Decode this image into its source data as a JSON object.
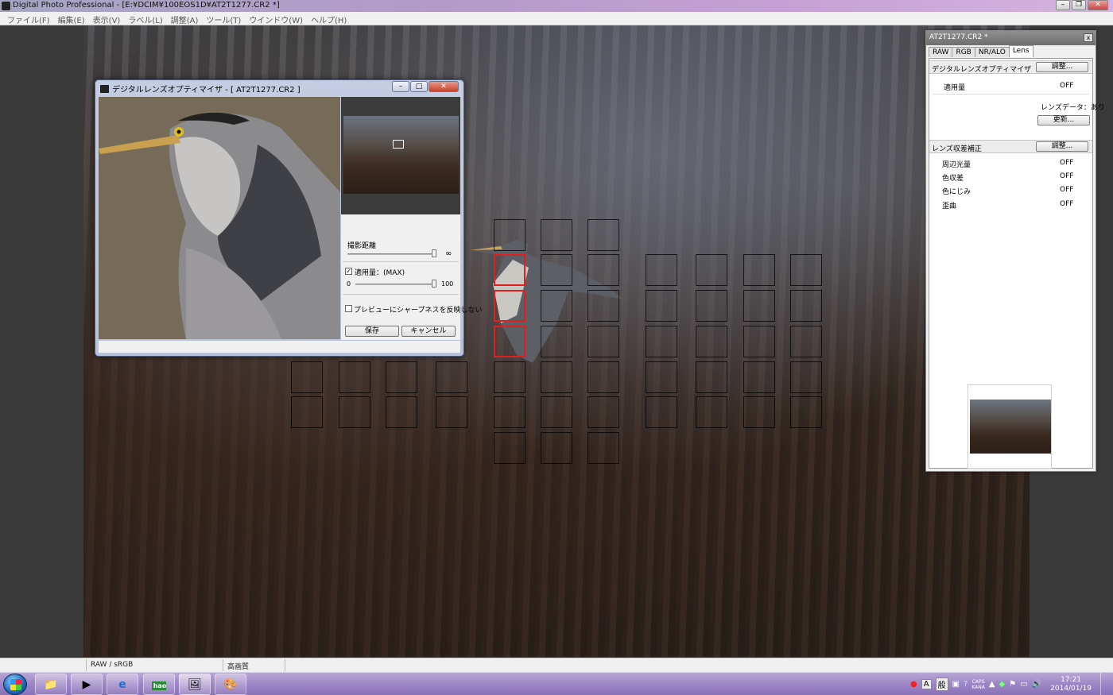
{
  "window": {
    "title": "Digital Photo Professional - [E:¥DCIM¥100EOS1D¥AT2T1277.CR2 *]",
    "controls": [
      "–",
      "❐",
      "✕"
    ]
  },
  "menu": [
    "ファイル(F)",
    "編集(E)",
    "表示(V)",
    "ラベル(L)",
    "調整(A)",
    "ツール(T)",
    "ウインドウ(W)",
    "ヘルプ(H)"
  ],
  "status": {
    "color_mode": "RAW / sRGB",
    "quality": "高画質"
  },
  "dlo": {
    "title": "デジタルレンズオプティマイザ - [ AT2T1277.CR2 ]",
    "controls": [
      "–",
      "□",
      "✕"
    ],
    "distance_label": "撮影距離",
    "distance_value": "∞",
    "apply_label": "適用量：(MAX)",
    "apply_checked": true,
    "apply_min": "0",
    "apply_max": "100",
    "no_sharpness_label": "プレビューにシャープネスを反映しない",
    "no_sharpness_checked": false,
    "save_label": "保存",
    "cancel_label": "キャンセル"
  },
  "palette": {
    "title": "AT2T1277.CR2 *",
    "close": "x",
    "tabs": [
      "RAW",
      "RGB",
      "NR/ALO",
      "Lens"
    ],
    "active_tab": "Lens",
    "dlo_section": {
      "label": "デジタルレンズオプティマイザ",
      "button": "調整...",
      "amount_label": "適用量",
      "amount_value": "OFF",
      "lens_data": "レンズデータ：あり",
      "update_button": "更新..."
    },
    "aberration_section": {
      "label": "レンズ収差補正",
      "button": "調整...",
      "items": [
        {
          "label": "周辺光量",
          "value": "OFF"
        },
        {
          "label": "色収差",
          "value": "OFF"
        },
        {
          "label": "色にじみ",
          "value": "OFF"
        },
        {
          "label": "歪曲",
          "value": "OFF"
        }
      ]
    }
  },
  "taskbar": {
    "ime_mode": "A",
    "ime_label": "般",
    "caps": "CAPS",
    "kana": "KANA",
    "time": "17:21",
    "date": "2014/01/19",
    "apps": [
      "folder-app",
      "media-player-app",
      "internet-explorer-app",
      "hao123-app",
      "digital-photo-professional-app",
      "paint-app"
    ],
    "hao123_label": "hao 123"
  },
  "colors": {
    "af_active": "#e02020",
    "taskbar": "#9d86c5"
  }
}
